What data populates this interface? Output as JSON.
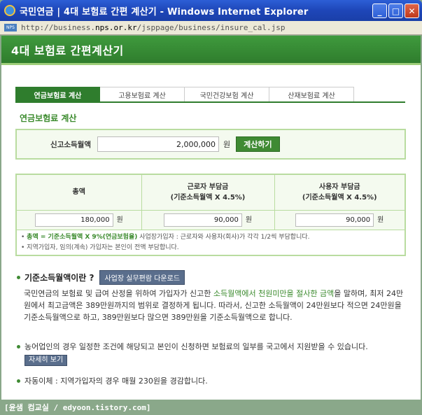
{
  "window": {
    "title": "국민연금 | 4대 보험료 간편 계산기 - Windows Internet Explorer",
    "address_prefix": "http://business.",
    "address_domain": "nps.or.kr",
    "address_suffix": "/jsppage/business/insure_cal.jsp",
    "minimize": "_",
    "maximize": "□",
    "close": "✕",
    "site_icon": "NPS"
  },
  "header": {
    "title": "4대 보험료 간편계산기"
  },
  "tabs": [
    {
      "label": "연금보험료 계산",
      "active": true
    },
    {
      "label": "고용보험료 계산",
      "active": false
    },
    {
      "label": "국민건강보험 계산",
      "active": false
    },
    {
      "label": "산재보험료 계산",
      "active": false
    }
  ],
  "section": {
    "title": "연금보험료 계산"
  },
  "income": {
    "label": "신고소득월액",
    "value": "2,000,000",
    "unit": "원",
    "button": "계산하기"
  },
  "results": {
    "col1": {
      "title": "총액",
      "value": "180,000",
      "unit": "원"
    },
    "col2": {
      "title": "근로자 부담금",
      "subtitle": "(기준소득월액 X 4.5%)",
      "value": "90,000",
      "unit": "원"
    },
    "col3": {
      "title": "사용자 부담금",
      "subtitle": "(기준소득월액 X 4.5%)",
      "value": "90,000",
      "unit": "원"
    }
  },
  "notes": {
    "note1_green": "총액 = 기준소득월액 X 9%(연금보험율)",
    "note1_rest": " 사업장가입자 : 근로자와 사용자(회사)가 각각 1/2씩 부담합니다.",
    "note2": "지역가입자, 임의(계속) 가입자는 본인이 전액 부담합니다."
  },
  "info": {
    "title": "기준소득월액이란 ?",
    "download_button": "사업장 실무편람 다운로드",
    "para1_a": "국민연금의 보험료 및 급여 산정을 위하여 가입자가 신고한 ",
    "para1_green": "소득월액에서 천원미만을 절사한 금액",
    "para1_b": "을 말하며, 최저 24만원에서 최고금액은 389만원까지의 범위로 결정하게 됩니다. 따라서, 신고한 소득월액이 24만원보다 적으면 24만원을 기준소득월액으로 하고, 389만원보다 많으면 389만원을 기준소득월액으로 합니다.",
    "para2": "농어업인의 경우 일정한 조건에 해당되고 본인이 신청하면 보험료의 일부를 국고에서 지원받을 수 있습니다.",
    "detail_button": "자세히 보기",
    "para3": "자동이체 : 지역가입자의 경우 매월 230원을 경감합니다."
  },
  "footer": {
    "watermark": "[윤샘 컴교실 / edyoon.tistory.com]"
  }
}
